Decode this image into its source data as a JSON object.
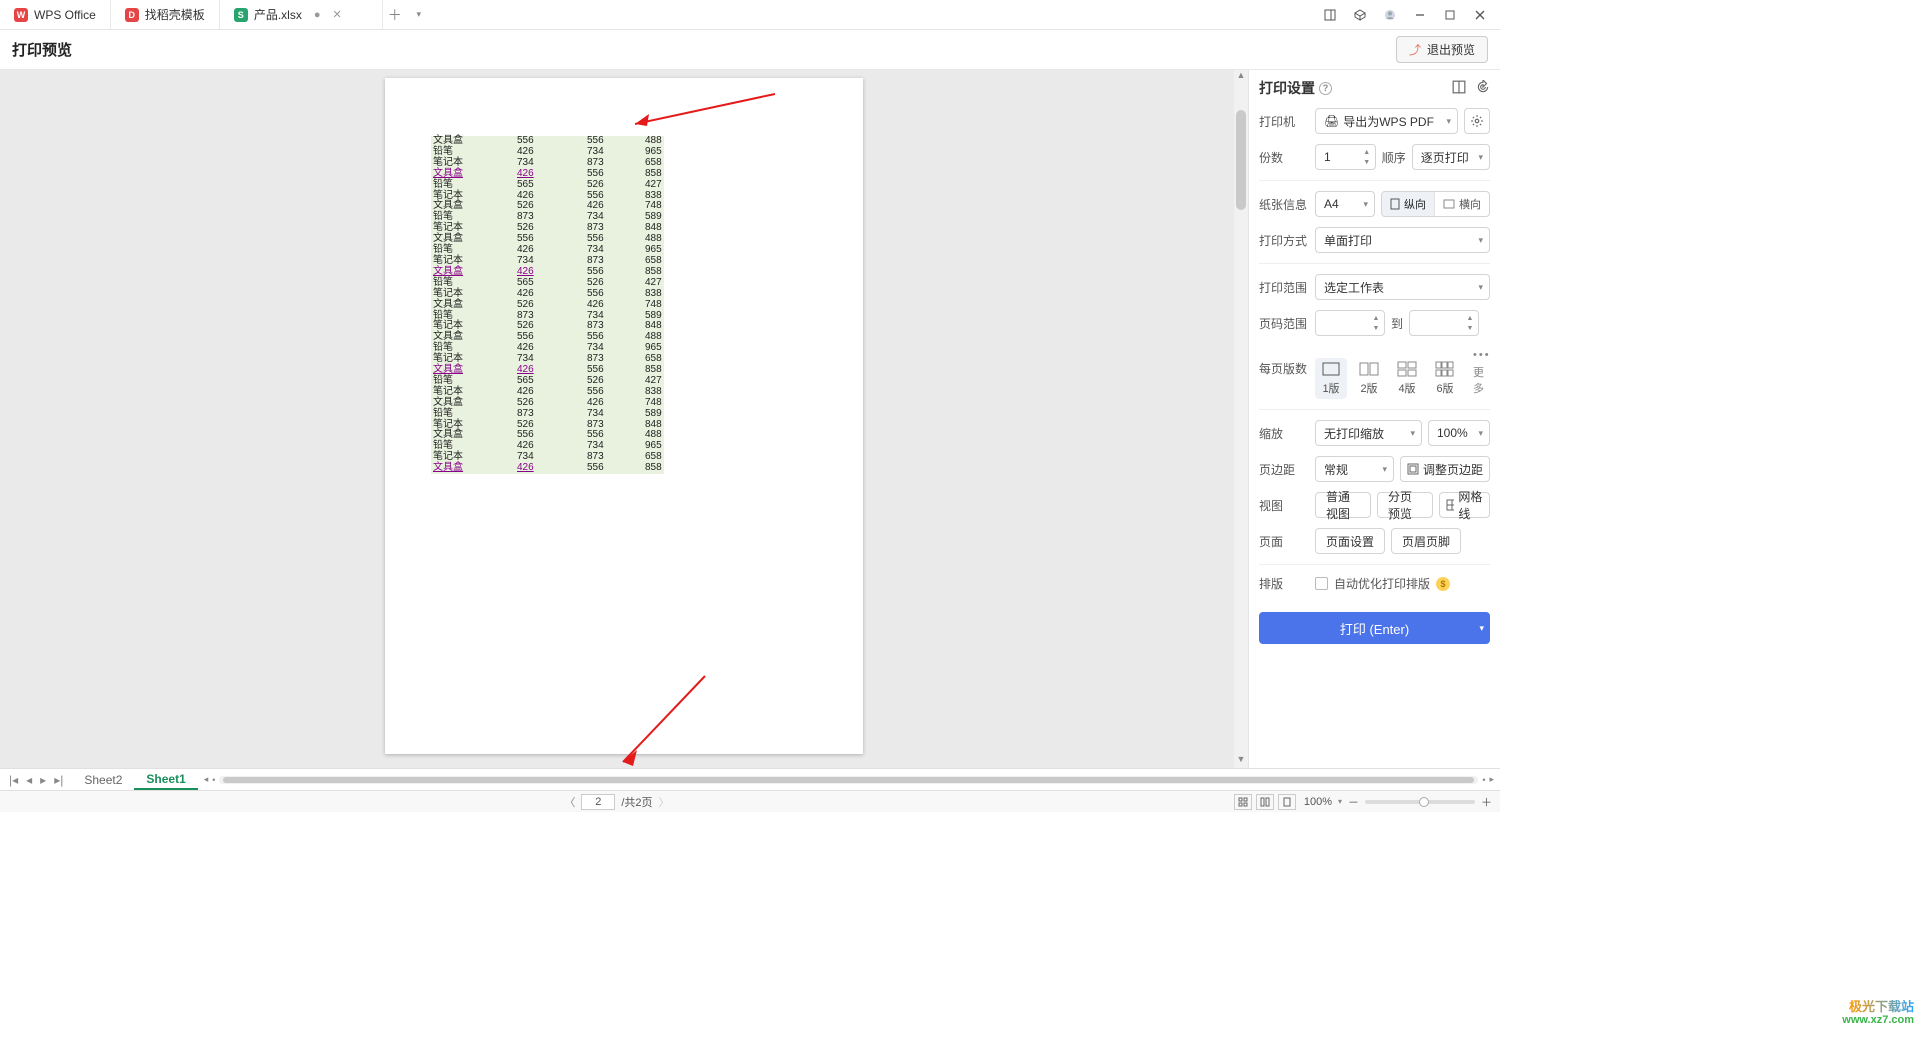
{
  "tabs": [
    {
      "label": "WPS Office",
      "color": "#e64545",
      "letter": "W"
    },
    {
      "label": "找稻壳模板",
      "color": "#e64545",
      "letter": "D"
    },
    {
      "label": "产品.xlsx",
      "color": "#28a46f",
      "letter": "S",
      "closable": true,
      "dirty": true
    }
  ],
  "header": {
    "title": "打印预览",
    "exit": "退出预览"
  },
  "panel": {
    "title": "打印设置",
    "printer_label": "打印机",
    "printer_value": "导出为WPS PDF",
    "copies_label": "份数",
    "copies_value": "1",
    "order_label": "顺序",
    "order_value": "逐页打印",
    "paper_label": "纸张信息",
    "paper_value": "A4",
    "orient_portrait": "纵向",
    "orient_landscape": "横向",
    "method_label": "打印方式",
    "method_value": "单面打印",
    "range_label": "打印范围",
    "range_value": "选定工作表",
    "page_range_label": "页码范围",
    "page_range_to": "到",
    "per_page_label": "每页版数",
    "per_page_opts": [
      "1版",
      "2版",
      "4版",
      "6版",
      "更多"
    ],
    "zoom_label": "缩放",
    "zoom_value": "无打印缩放",
    "zoom_pct": "100%",
    "margin_label": "页边距",
    "margin_value": "常规",
    "margin_adjust": "调整页边距",
    "view_label": "视图",
    "view_normal": "普通视图",
    "view_paged": "分页预览",
    "view_grid": "网格线",
    "page_label": "页面",
    "page_setup": "页面设置",
    "page_hf": "页眉页脚",
    "layout_label": "排版",
    "auto_opt": "自动优化打印排版",
    "print_btn": "打印 (Enter)"
  },
  "sheets": {
    "s2": "Sheet2",
    "s1": "Sheet1"
  },
  "status": {
    "page_current": "2",
    "page_total": "/共2页",
    "zoom": "100%"
  },
  "watermark": {
    "line1": "极光下载站",
    "line2": "www.xz7.com"
  },
  "table_rows": [
    [
      "文具盒",
      "556",
      "556",
      "488",
      false
    ],
    [
      "铅笔",
      "426",
      "734",
      "965",
      false
    ],
    [
      "笔记本",
      "734",
      "873",
      "658",
      false
    ],
    [
      "文具盒",
      "426",
      "556",
      "858",
      true
    ],
    [
      "铅笔",
      "565",
      "526",
      "427",
      false
    ],
    [
      "笔记本",
      "426",
      "556",
      "838",
      false
    ],
    [
      "文具盒",
      "526",
      "426",
      "748",
      false
    ],
    [
      "铅笔",
      "873",
      "734",
      "589",
      false
    ],
    [
      "笔记本",
      "526",
      "873",
      "848",
      false
    ],
    [
      "文具盒",
      "556",
      "556",
      "488",
      false
    ],
    [
      "铅笔",
      "426",
      "734",
      "965",
      false
    ],
    [
      "笔记本",
      "734",
      "873",
      "658",
      false
    ],
    [
      "文具盒",
      "426",
      "556",
      "858",
      true
    ],
    [
      "铅笔",
      "565",
      "526",
      "427",
      false
    ],
    [
      "笔记本",
      "426",
      "556",
      "838",
      false
    ],
    [
      "文具盒",
      "526",
      "426",
      "748",
      false
    ],
    [
      "铅笔",
      "873",
      "734",
      "589",
      false
    ],
    [
      "笔记本",
      "526",
      "873",
      "848",
      false
    ],
    [
      "文具盒",
      "556",
      "556",
      "488",
      false
    ],
    [
      "铅笔",
      "426",
      "734",
      "965",
      false
    ],
    [
      "笔记本",
      "734",
      "873",
      "658",
      false
    ],
    [
      "文具盒",
      "426",
      "556",
      "858",
      true
    ],
    [
      "铅笔",
      "565",
      "526",
      "427",
      false
    ],
    [
      "笔记本",
      "426",
      "556",
      "838",
      false
    ],
    [
      "文具盒",
      "526",
      "426",
      "748",
      false
    ],
    [
      "铅笔",
      "873",
      "734",
      "589",
      false
    ],
    [
      "笔记本",
      "526",
      "873",
      "848",
      false
    ],
    [
      "文具盒",
      "556",
      "556",
      "488",
      false
    ],
    [
      "铅笔",
      "426",
      "734",
      "965",
      false
    ],
    [
      "笔记本",
      "734",
      "873",
      "658",
      false
    ],
    [
      "文具盒",
      "426",
      "556",
      "858",
      true
    ]
  ]
}
